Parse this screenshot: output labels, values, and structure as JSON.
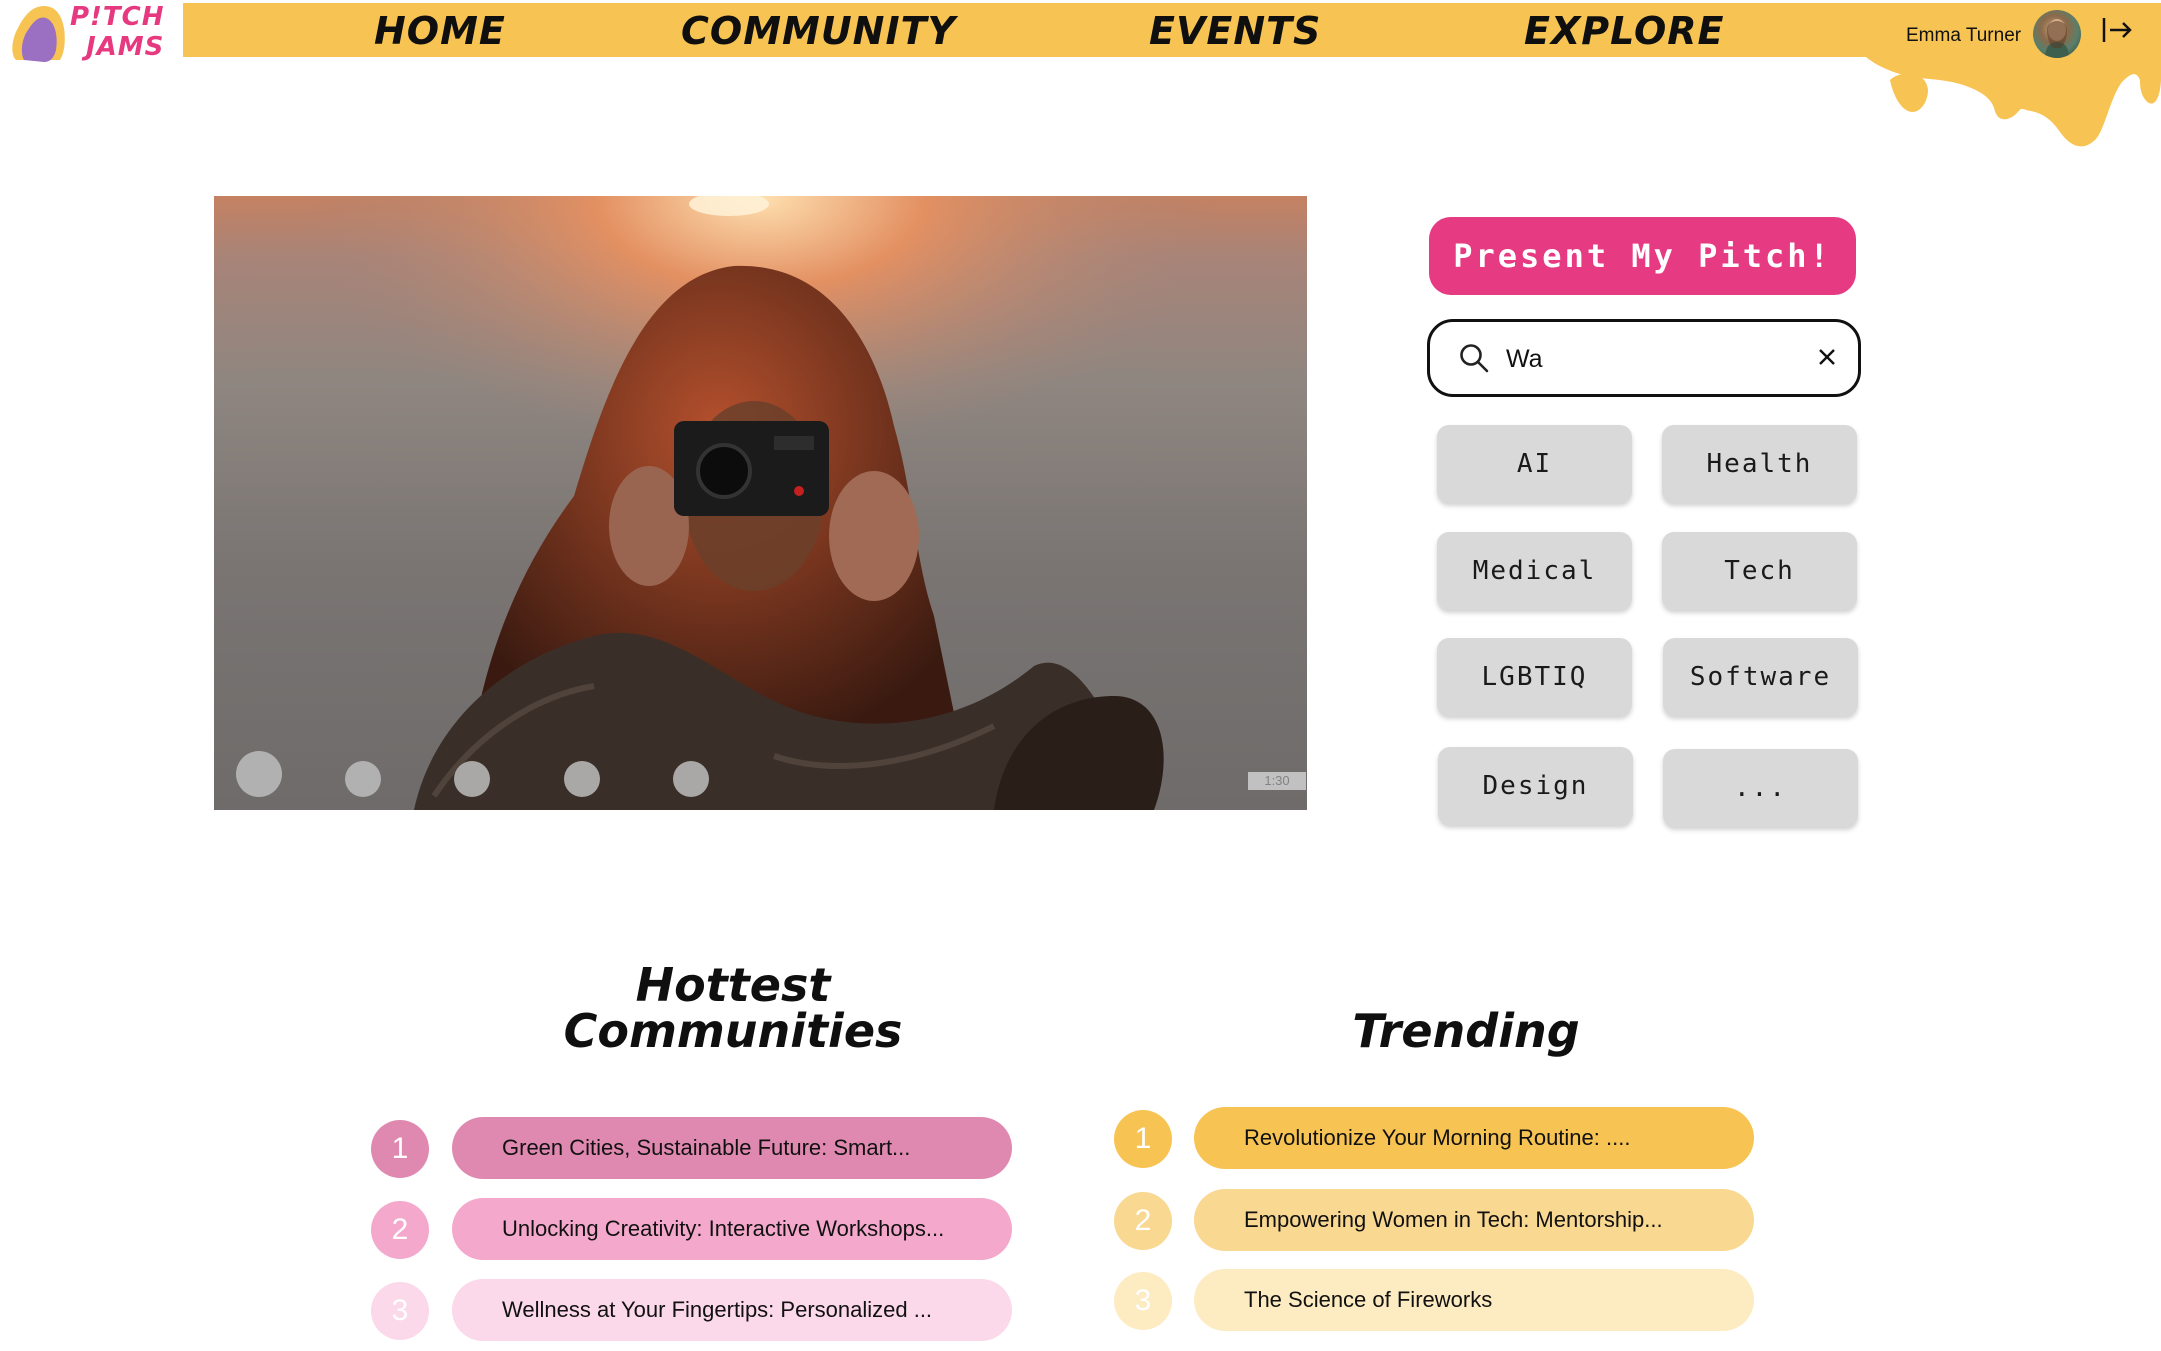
{
  "header": {
    "logo": {
      "line1": "P!TCH",
      "line2": "JAMS"
    },
    "nav": [
      "HOME",
      "COMMUNITY",
      "EVENTS",
      "EXPLORE"
    ],
    "user_name": "Emma Turner"
  },
  "hero": {
    "timestamp": "1:30",
    "slide_count": 5,
    "active_slide": 1
  },
  "right_panel": {
    "pitch_button": "Present My Pitch!",
    "search": {
      "value": "Wa"
    },
    "tags": [
      "AI",
      "Health",
      "Medical",
      "Tech",
      "LGBTIQ",
      "Software",
      "Design",
      "..."
    ]
  },
  "hottest": {
    "title_line1": "Hottest",
    "title_line2": "Communities",
    "items": [
      {
        "rank": "1",
        "label": "Green Cities, Sustainable Future: Smart..."
      },
      {
        "rank": "2",
        "label": "Unlocking Creativity: Interactive Workshops..."
      },
      {
        "rank": "3",
        "label": "Wellness at Your Fingertips: Personalized ..."
      }
    ]
  },
  "trending": {
    "title": "Trending",
    "items": [
      {
        "rank": "1",
        "label": "Revolutionize Your Morning Routine: ...."
      },
      {
        "rank": "2",
        "label": "Empowering Women in Tech: Mentorship..."
      },
      {
        "rank": "3",
        "label": "The Science of Fireworks"
      }
    ]
  },
  "colors": {
    "header_yellow": "#f7c453",
    "accent_pink": "#e63a82",
    "logo_purple": "#9b6fc1",
    "hot_1": "#e089b0",
    "hot_2": "#f4a9cc",
    "hot_3": "#fbd8ea",
    "trend_1": "#f7c453",
    "trend_2": "#f9d891",
    "trend_3": "#fdebc2",
    "tag_gray": "#d9d9d9"
  },
  "icons": [
    "logo-blob-icon",
    "logout-icon",
    "search-icon",
    "close-icon"
  ]
}
